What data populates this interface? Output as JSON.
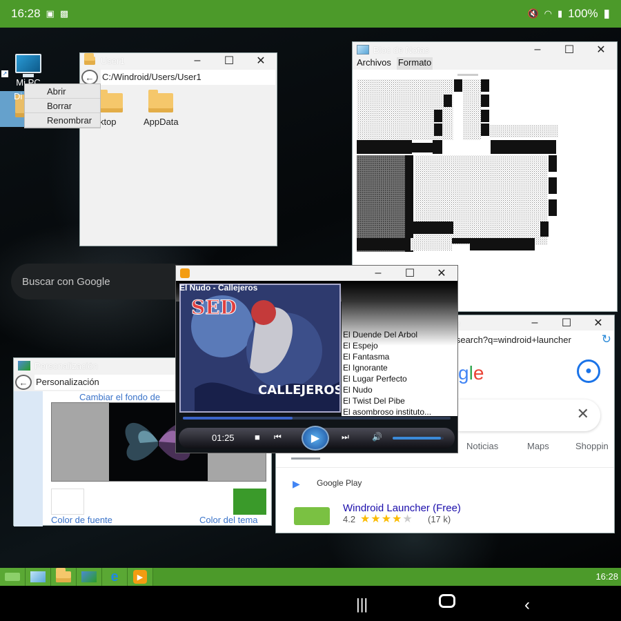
{
  "status_bar": {
    "time": "16:28",
    "battery": "100%"
  },
  "desktop": {
    "icons": [
      {
        "label": "Mi PC"
      },
      {
        "label": "Di"
      }
    ]
  },
  "context_menu": {
    "items": [
      "Abrir",
      "Borrar",
      "Renombrar"
    ]
  },
  "explorer": {
    "title": "User1",
    "path": "C:/Windroid/Users/User1",
    "items": [
      "sktop",
      "AppData"
    ]
  },
  "notepad": {
    "title": "Bloc de Notas",
    "menu": [
      "Archivos",
      "Formato"
    ]
  },
  "google_search_widget": {
    "placeholder": "Buscar con Google"
  },
  "personalizacion": {
    "title": "Personalización",
    "path": "Personalización",
    "change_bg_link": "Cambiar el fondo de",
    "font_color_link": "Color de fuente",
    "theme_color_link": "Color del tema",
    "theme_color": "#3a9a2a"
  },
  "browser": {
    "title_fragment": "gle",
    "url": "n/search?q=windroid+launcher",
    "logo_fragment": "gle",
    "tabs": [
      "Noticias",
      "Maps",
      "Shoppin"
    ],
    "source": "Google Play",
    "result_title": "Windroid Launcher (Free)",
    "rating": "4.2",
    "rating_value": 4.2,
    "reviews": "(17 k)"
  },
  "player": {
    "now_playing": "El Nudo - Callejeros",
    "playlist": [
      "El Duende Del Arbol",
      "El Espejo",
      "El Fantasma",
      "El Ignorante",
      "El Lugar Perfecto",
      "El Nudo",
      "El Twist Del Pibe",
      "El asombroso instituto..."
    ],
    "time": "01:25",
    "progress": 0.41,
    "volume": 0.95,
    "cover_text_top": "SED",
    "cover_text_bottom": "CALLEJEROS"
  },
  "taskbar": {
    "clock": "16:28"
  },
  "colors": {
    "accent_green": "#4c9a2a",
    "link_blue": "#3a73c9"
  }
}
